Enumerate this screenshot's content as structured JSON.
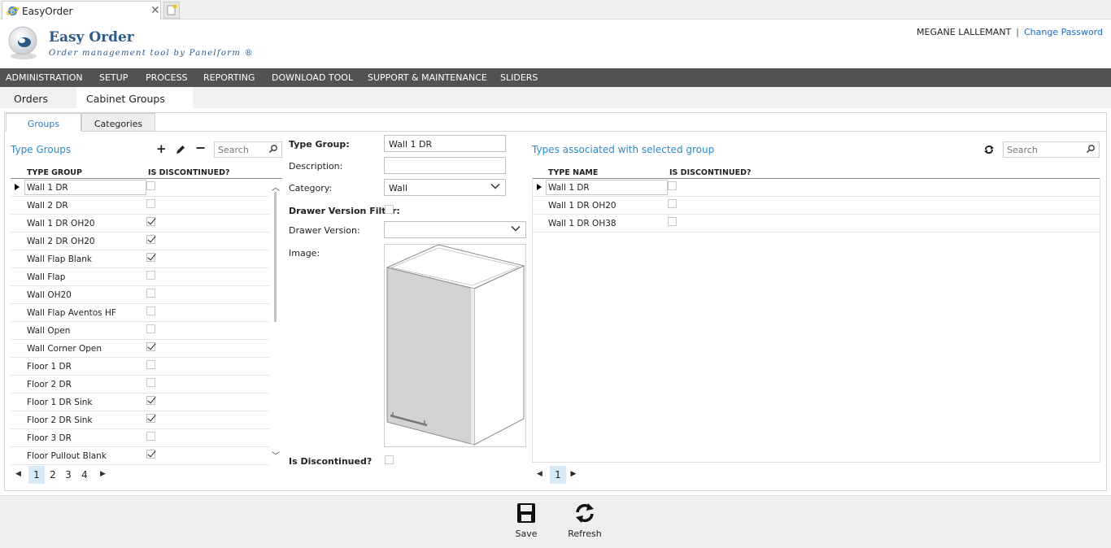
{
  "browser": {
    "tab_title": "EasyOrder",
    "close_glyph": "✕"
  },
  "header": {
    "app_name": "Easy Order",
    "tagline": "Order management tool by Panelform ®",
    "user_name": "MEGANE LALLEMANT",
    "separator": "|",
    "change_password": "Change Password"
  },
  "menu": [
    "ADMINISTRATION",
    "SETUP",
    "PROCESS",
    "REPORTING",
    "DOWNLOAD TOOL",
    "SUPPORT & MAINTENANCE",
    "SLIDERS"
  ],
  "page_tabs": [
    "Orders",
    "Cabinet Groups"
  ],
  "sub_tabs": [
    "Groups",
    "Categories"
  ],
  "left": {
    "title": "Type Groups",
    "search_placeholder": "Search",
    "col_type_group": "TYPE GROUP",
    "col_discontinued": "IS DISCONTINUED?",
    "rows": [
      {
        "name": "Wall 1 DR",
        "discontinued": false,
        "selected": true
      },
      {
        "name": "Wall 2 DR",
        "discontinued": false
      },
      {
        "name": "Wall 1 DR OH20",
        "discontinued": true
      },
      {
        "name": "Wall 2 DR OH20",
        "discontinued": true
      },
      {
        "name": "Wall Flap Blank",
        "discontinued": true
      },
      {
        "name": "Wall Flap",
        "discontinued": false
      },
      {
        "name": "Wall OH20",
        "discontinued": false
      },
      {
        "name": "Wall Flap Aventos HF",
        "discontinued": false
      },
      {
        "name": "Wall Open",
        "discontinued": false
      },
      {
        "name": "Wall Corner Open",
        "discontinued": true
      },
      {
        "name": "Floor 1 DR",
        "discontinued": false
      },
      {
        "name": "Floor 2 DR",
        "discontinued": false
      },
      {
        "name": "Floor 1 DR Sink",
        "discontinued": true
      },
      {
        "name": "Floor 2 DR Sink",
        "discontinued": true
      },
      {
        "name": "Floor 3 DR",
        "discontinued": false
      },
      {
        "name": "Floor Pullout Blank",
        "discontinued": true
      }
    ],
    "pages": [
      "1",
      "2",
      "3",
      "4"
    ],
    "current_page": "1"
  },
  "form": {
    "type_group_label": "Type Group:",
    "type_group_value": "Wall 1 DR",
    "description_label": "Description:",
    "description_value": "",
    "category_label": "Category:",
    "category_value": "Wall",
    "drawer_filter_label": "Drawer Version Filter:",
    "drawer_filter_checked": false,
    "drawer_version_label": "Drawer Version:",
    "drawer_version_value": "",
    "image_label": "Image:",
    "discontinued_label": "Is Discontinued?",
    "discontinued_checked": false
  },
  "right": {
    "title": "Types associated with selected group",
    "search_placeholder": "Search",
    "col_type_name": "TYPE NAME",
    "col_discontinued": "IS DISCONTINUED?",
    "rows": [
      {
        "name": "Wall 1 DR",
        "discontinued": false,
        "selected": true
      },
      {
        "name": "Wall 1 DR OH20",
        "discontinued": false
      },
      {
        "name": "Wall 1 DR OH38",
        "discontinued": false
      }
    ],
    "pages": [
      "1"
    ]
  },
  "footer": {
    "save_label": "Save",
    "refresh_label": "Refresh"
  },
  "colors": {
    "menu_bg": "#525252",
    "accent": "#2b8cc4",
    "brand": "#2b5a86"
  }
}
